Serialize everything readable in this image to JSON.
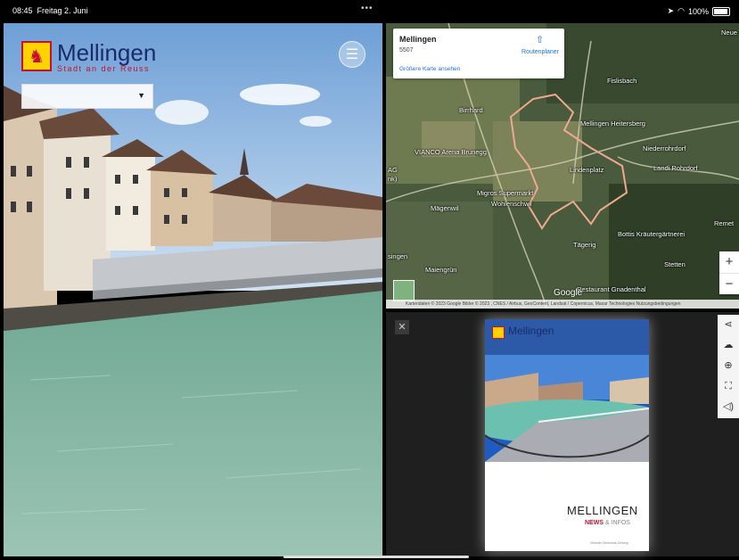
{
  "status_bar": {
    "time": "08:45",
    "date": "Freitag 2. Juni",
    "battery": "100%"
  },
  "site": {
    "name": "Mellingen",
    "tagline": "Stadt an der Reuss"
  },
  "map": {
    "card": {
      "title": "Mellingen",
      "zip": "5507",
      "larger_map_link": "Größere Karte ansehen",
      "route_label": "Routenplaner"
    },
    "labels": [
      "Fislisbach",
      "Mellingen Heitersberg",
      "Niederrohrdorf",
      "Landi Rohrdorf",
      "Lindenplatz",
      "Birrhard",
      "VIANCO Arena Brunegg",
      "Migros Supermarkt",
      "Wohlenschwil",
      "Mägenwil",
      "Tägerig",
      "Bottis Kräutergärtnerei",
      "Stetten",
      "Maiengrün",
      "Restaurant Gnadenthal",
      "Remet",
      "Neue",
      "singen",
      "AG",
      "nk)"
    ],
    "google": "Google",
    "attribution": "Kartendaten © 2023 Google Bilder © 2023 , CNES / Airbus, GeoContent, Landsat / Copernicus, Maxar Technologies  Nutzungsbedingungen",
    "zoom_in": "+",
    "zoom_out": "−"
  },
  "viewer": {
    "close": "✕",
    "tools": [
      "share-icon",
      "download-icon",
      "zoom-icon",
      "fullscreen-icon",
      "sound-icon"
    ],
    "cover": {
      "brand": "Mellingen",
      "title": "MELLINGEN",
      "news": "NEWS",
      "infos": "& INFOS",
      "footer": "Virtuelle Gemeinde-Zeitung"
    }
  },
  "colors": {
    "brand_blue": "#1b2a6b",
    "brand_red": "#c8102e",
    "brand_yellow": "#ffd200",
    "map_link": "#1a73e8"
  }
}
